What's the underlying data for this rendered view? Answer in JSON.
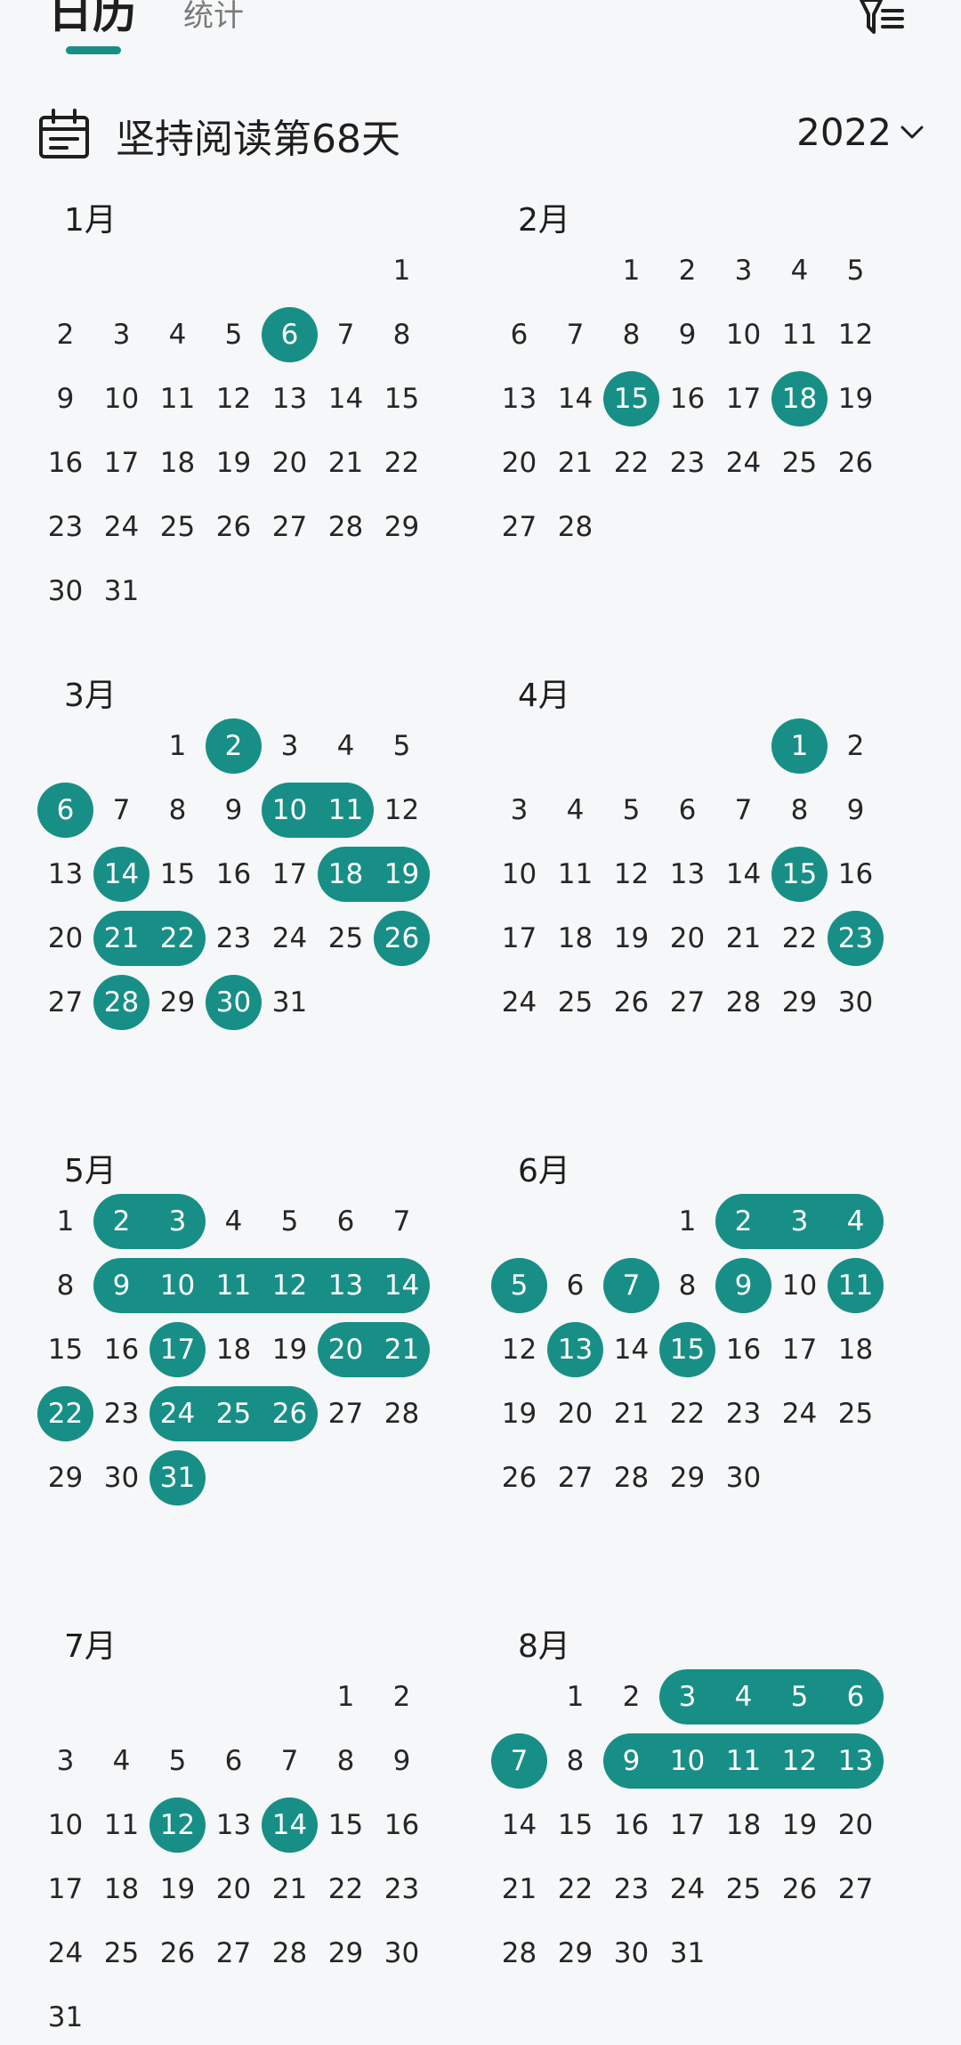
{
  "tabs": [
    {
      "label": "日历",
      "active": true
    },
    {
      "label": "统计",
      "active": false
    }
  ],
  "header": {
    "filter_icon": "filter-list-icon",
    "calendar_icon": "calendar-icon",
    "headline": "坚持阅读第68天",
    "year": "2022",
    "year_icon": "chevron-down-icon"
  },
  "colors": {
    "accent": "#178f87",
    "background": "#f6f7f8",
    "text": "#1e1e1e"
  },
  "months": [
    {
      "label": "1月",
      "first_weekday": 6,
      "days": 31,
      "read": [
        6
      ]
    },
    {
      "label": "2月",
      "first_weekday": 2,
      "days": 28,
      "read": [
        15,
        18
      ]
    },
    {
      "label": "3月",
      "first_weekday": 2,
      "days": 31,
      "read": [
        2,
        6,
        10,
        11,
        14,
        18,
        19,
        21,
        22,
        26,
        28,
        30
      ]
    },
    {
      "label": "4月",
      "first_weekday": 5,
      "days": 30,
      "read": [
        1,
        15,
        23
      ]
    },
    {
      "label": "5月",
      "first_weekday": 0,
      "days": 31,
      "read": [
        2,
        3,
        9,
        10,
        11,
        12,
        13,
        14,
        17,
        20,
        21,
        22,
        24,
        25,
        26,
        31
      ]
    },
    {
      "label": "6月",
      "first_weekday": 3,
      "days": 30,
      "read": [
        2,
        3,
        4,
        5,
        7,
        9,
        11,
        13,
        15
      ]
    },
    {
      "label": "7月",
      "first_weekday": 5,
      "days": 31,
      "read": [
        12,
        14
      ]
    },
    {
      "label": "8月",
      "first_weekday": 1,
      "days": 31,
      "read": [
        3,
        4,
        5,
        6,
        7,
        9,
        10,
        11,
        12,
        13
      ]
    }
  ]
}
